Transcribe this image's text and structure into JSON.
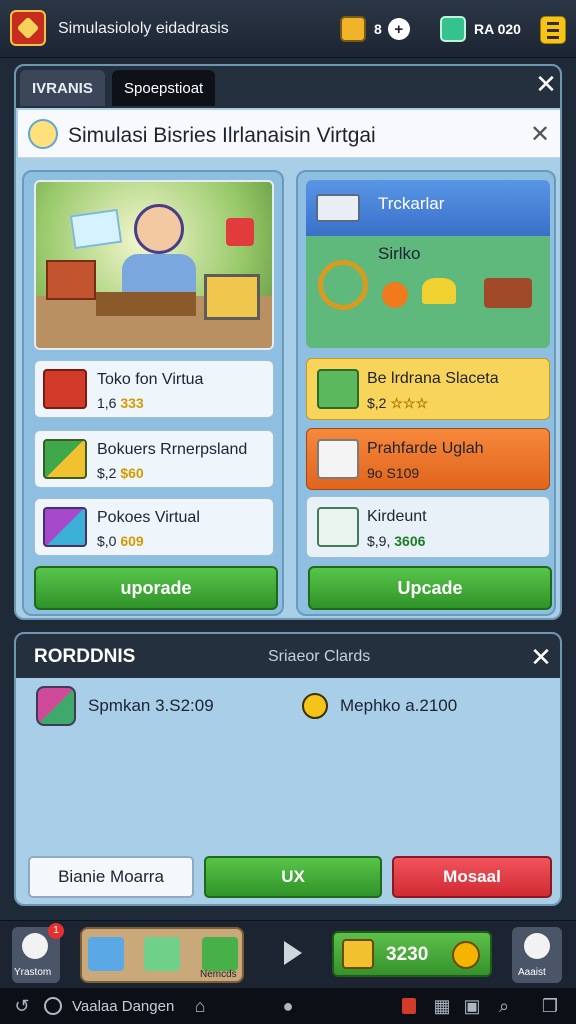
{
  "app": {
    "title": "Simulasiololy",
    "title_suffix": "eidadrasis"
  },
  "resources": {
    "coins": "8",
    "gems": "RA 020"
  },
  "tabs": [
    {
      "label": "IVRANIS"
    },
    {
      "label": "Spoepstioat"
    }
  ],
  "panel": {
    "title": "Simulasi Bisries Ilrlanaisin Virtgai",
    "close_glyph": "✕"
  },
  "left_column": {
    "items": [
      {
        "name": "Toko fon Virtua",
        "price": "1,6",
        "price_tag": "333"
      },
      {
        "name": "Bokuers Rrnerpsland",
        "price": "$,2",
        "price_tag": "$60"
      },
      {
        "name": "Pokoes Virtual",
        "price": "$,0",
        "price_tag": "609"
      }
    ],
    "upgrade_label": "uporade"
  },
  "right_column": {
    "header": "Trckarlar",
    "art_label": "Sirlko",
    "items": [
      {
        "name": "Be lrdrana Slaceta",
        "price": "$,2",
        "price_tag": "☆☆☆"
      },
      {
        "name": "Prahfarde Uglah",
        "price": "9o",
        "price_tag": "S109"
      },
      {
        "name": "Kirdeunt",
        "price": "$,9,",
        "price_tag": "3606"
      }
    ],
    "upgrade_label": "Upcade"
  },
  "dialog": {
    "title": "RORDDNIS",
    "subtitle": "Sriaeor Clards",
    "close_glyph": "✕",
    "stat_1": "Spmkan 3.S2:09",
    "stat_2": "Mephko a.2100",
    "buttons": {
      "left": "Bianie Moarra",
      "middle": "UX",
      "right": "Mosaal"
    }
  },
  "dock": {
    "left_label": "Yrastom",
    "left_badge": "1",
    "tray_label": "Nemcds",
    "money": "3230",
    "right_label": "Aaaist"
  },
  "navbar": {
    "label": "Vaalaa Dangen"
  },
  "colors": {
    "accent_green": "#2f9428",
    "accent_red": "#d12a33",
    "accent_orange": "#e0651c",
    "accent_yellow": "#f8d45a",
    "panel_bg": "#a8cfe7",
    "header_dark": "#25303f"
  },
  "icons": {
    "app_logo": "shield-logo-icon",
    "coins": "coin-bag-icon",
    "gems": "gem-box-icon",
    "menu": "hamburger-menu-icon"
  }
}
